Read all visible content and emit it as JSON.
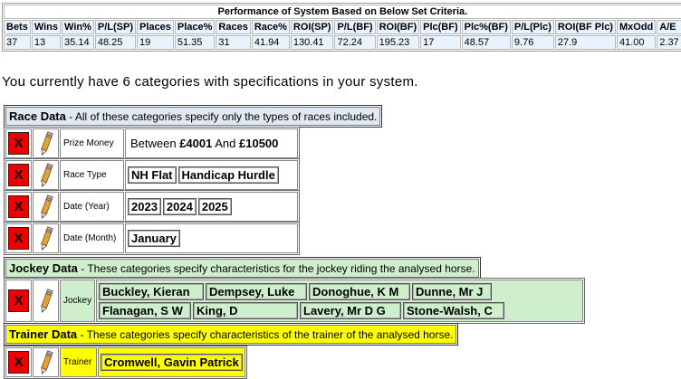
{
  "performance": {
    "title": "Performance of System Based on Below Set Criteria.",
    "headers": [
      "Bets",
      "Wins",
      "Win%",
      "P/L(SP)",
      "Places",
      "Place%",
      "Races",
      "Race%",
      "ROI(SP)",
      "P/L(BF)",
      "ROI(BF)",
      "Plc(BF)",
      "Plc%(BF)",
      "P/L(Plc)",
      "ROI(BF Plc)",
      "MxOdd",
      "A/E"
    ],
    "values": [
      "37",
      "13",
      "35.14",
      "48.25",
      "19",
      "51.35",
      "31",
      "41.94",
      "130.41",
      "72.24",
      "195.23",
      "17",
      "48.57",
      "9.76",
      "27.9",
      "41.00",
      "2.37"
    ]
  },
  "summary": "You currently have 6 categories with specifications in your system.",
  "race_data": {
    "title": "Race Data",
    "desc": " - All of these categories specify only the types of races included.",
    "rows": [
      {
        "label": "Prize Money",
        "prefix": "Between ",
        "v1": "£4001",
        "mid": " And ",
        "v2": "£10500"
      },
      {
        "label": "Race Type",
        "values": [
          "NH Flat",
          "Handicap Hurdle"
        ]
      },
      {
        "label": "Date (Year)",
        "values": [
          "2023",
          "2024",
          "2025"
        ]
      },
      {
        "label": "Date (Month)",
        "values": [
          "January"
        ]
      }
    ]
  },
  "jockey_data": {
    "title": "Jockey Data",
    "desc": " - These categories specify characteristics for the jockey riding the analysed horse.",
    "label": "Jockey",
    "values": [
      "Buckley, Kieran",
      "Dempsey, Luke",
      "Donoghue, K M",
      "Dunne, Mr J",
      "Flanagan, S W",
      "King, D",
      "Lavery, Mr D G",
      "Stone-Walsh, C"
    ]
  },
  "trainer_data": {
    "title": "Trainer Data",
    "desc": " - These categories specify characteristics of the trainer of the analysed horse.",
    "label": "Trainer",
    "values": [
      "Cromwell, Gavin Patrick"
    ]
  },
  "delete_label": "X",
  "colors": {
    "delete": "#ee0000",
    "race_bg": "#dfe8f3",
    "jockey_bg": "#cfeecc",
    "trainer_bg": "#ffff00",
    "perf_bg": "#e9f2ff"
  }
}
